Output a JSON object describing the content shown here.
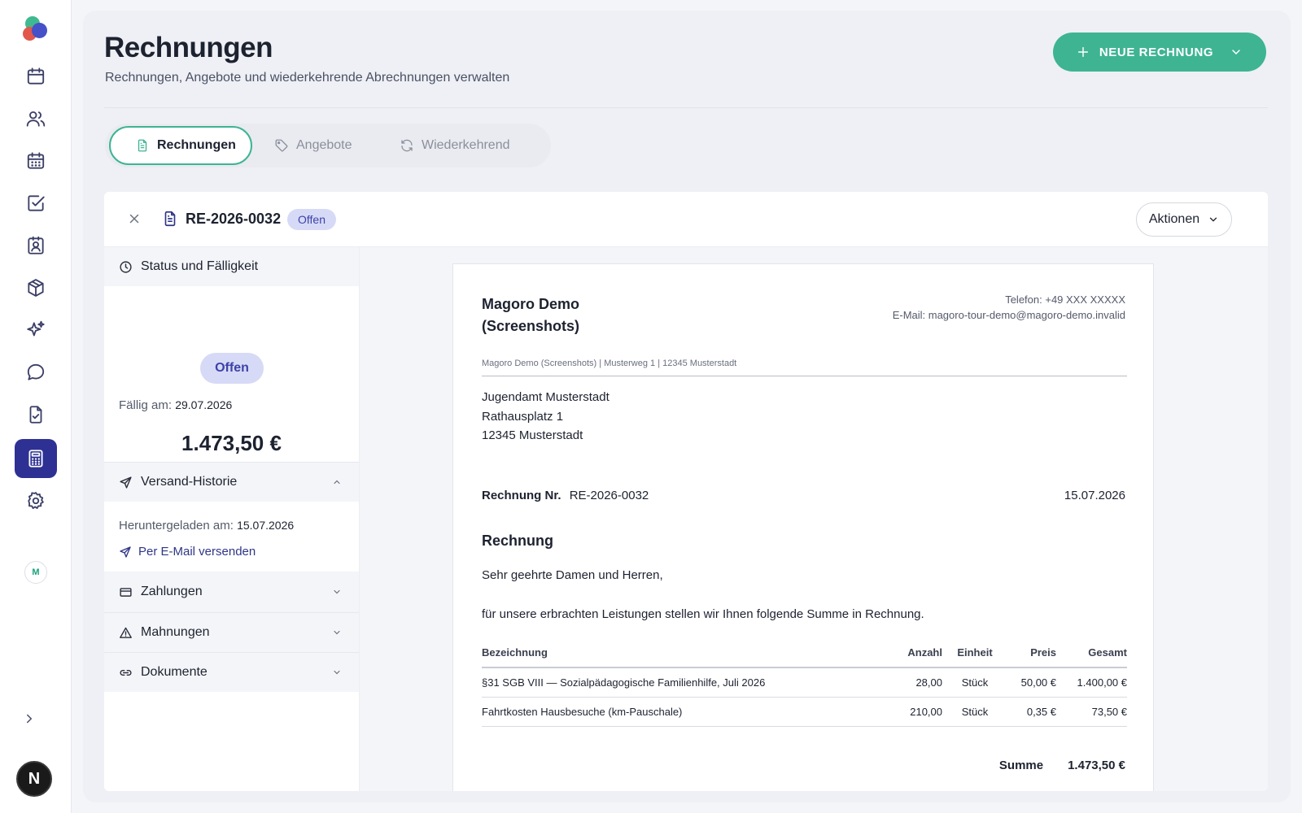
{
  "header": {
    "title": "Rechnungen",
    "subtitle": "Rechnungen, Angebote und wiederkehrende Abrechnungen verwalten",
    "new_button_label": "NEUE RECHNUNG"
  },
  "tabs": [
    {
      "label": "Rechnungen",
      "icon": "document-icon",
      "active": true
    },
    {
      "label": "Angebote",
      "icon": "tag-icon",
      "active": false
    },
    {
      "label": "Wiederkehrend",
      "icon": "refresh-icon",
      "active": false
    }
  ],
  "sidebar": {
    "items": [
      "calendar-icon",
      "users-icon",
      "calendar-grid-icon",
      "checkbox-icon",
      "contact-card-icon",
      "package-icon",
      "sparkles-icon",
      "chat-icon",
      "document-check-icon",
      "calculator-icon",
      "gear-icon"
    ],
    "active_item": "calculator-icon",
    "workspace_initial": "M",
    "user_initial": "N"
  },
  "invoice": {
    "number": "RE-2026-0032",
    "status": "Offen",
    "actions_label": "Aktionen"
  },
  "left_panel": {
    "status_section": "Status und Fälligkeit",
    "status_pill": "Offen",
    "due_label": "Fällig am:",
    "due_date": "29.07.2026",
    "amount": "1.473,50 €",
    "dispatch_section": "Versand-Historie",
    "downloaded_label": "Heruntergeladen am:",
    "downloaded_date": "15.07.2026",
    "send_email_label": "Per E-Mail versenden",
    "payments_section": "Zahlungen",
    "reminders_section": "Mahnungen",
    "documents_section": "Dokumente"
  },
  "document": {
    "company_line1": "Magoro Demo",
    "company_line2": "(Screenshots)",
    "phone": "Telefon: +49 XXX XXXXX",
    "email": "E-Mail: magoro-tour-demo@magoro-demo.invalid",
    "sender_line": "Magoro Demo (Screenshots) | Musterweg 1 | 12345 Musterstadt",
    "recipient": [
      "Jugendamt Musterstadt",
      "Rathausplatz 1",
      "12345 Musterstadt"
    ],
    "invoice_no_label": "Rechnung Nr.",
    "invoice_no": "RE-2026-0032",
    "date": "15.07.2026",
    "heading": "Rechnung",
    "salutation": "Sehr geehrte Damen und Herren,",
    "intro": "für unsere erbrachten Leistungen stellen wir Ihnen folgende Summe in Rechnung.",
    "columns": [
      "Bezeichnung",
      "Anzahl",
      "Einheit",
      "Preis",
      "Gesamt"
    ],
    "rows": [
      [
        "§31 SGB VIII — Sozialpädagogische Familienhilfe, Juli 2026",
        "28,00",
        "Stück",
        "50,00 €",
        "1.400,00 €"
      ],
      [
        "Fahrtkosten Hausbesuche (km-Pauschale)",
        "210,00",
        "Stück",
        "0,35 €",
        "73,50 €"
      ]
    ],
    "sum_label": "Summe",
    "sum_value": "1.473,50 €"
  },
  "colors": {
    "accent_green": "#3eb493",
    "brand_indigo": "#2e3193",
    "badge_bg": "#d7daf6"
  }
}
